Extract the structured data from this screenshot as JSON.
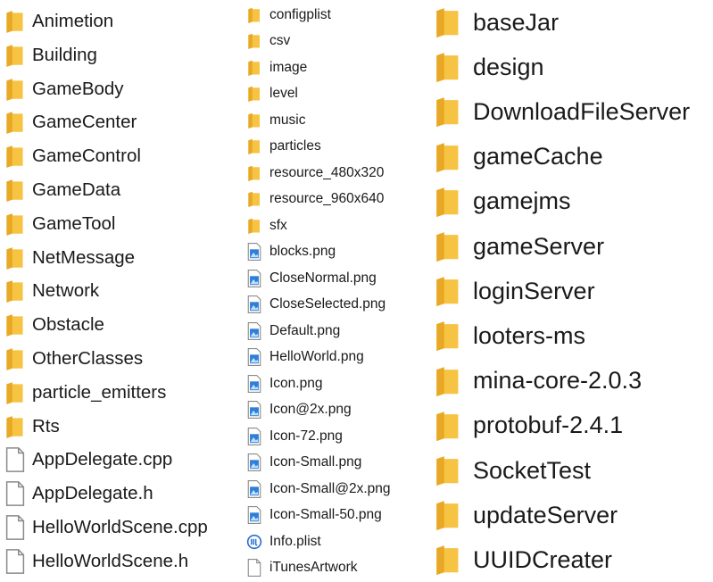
{
  "columns": [
    {
      "items": [
        {
          "name": "Animetion",
          "type": "folder"
        },
        {
          "name": "Building",
          "type": "folder"
        },
        {
          "name": "GameBody",
          "type": "folder"
        },
        {
          "name": "GameCenter",
          "type": "folder"
        },
        {
          "name": "GameControl",
          "type": "folder"
        },
        {
          "name": "GameData",
          "type": "folder"
        },
        {
          "name": "GameTool",
          "type": "folder"
        },
        {
          "name": "NetMessage",
          "type": "folder"
        },
        {
          "name": "Network",
          "type": "folder"
        },
        {
          "name": "Obstacle",
          "type": "folder"
        },
        {
          "name": "OtherClasses",
          "type": "folder"
        },
        {
          "name": "particle_emitters",
          "type": "folder"
        },
        {
          "name": "Rts",
          "type": "folder"
        },
        {
          "name": "AppDelegate.cpp",
          "type": "file"
        },
        {
          "name": "AppDelegate.h",
          "type": "file"
        },
        {
          "name": "HelloWorldScene.cpp",
          "type": "file"
        },
        {
          "name": "HelloWorldScene.h",
          "type": "file"
        }
      ]
    },
    {
      "items": [
        {
          "name": "configplist",
          "type": "folder"
        },
        {
          "name": "csv",
          "type": "folder"
        },
        {
          "name": "image",
          "type": "folder"
        },
        {
          "name": "level",
          "type": "folder"
        },
        {
          "name": "music",
          "type": "folder"
        },
        {
          "name": "particles",
          "type": "folder"
        },
        {
          "name": "resource_480x320",
          "type": "folder"
        },
        {
          "name": "resource_960x640",
          "type": "folder"
        },
        {
          "name": "sfx",
          "type": "folder"
        },
        {
          "name": "blocks.png",
          "type": "image"
        },
        {
          "name": "CloseNormal.png",
          "type": "image"
        },
        {
          "name": "CloseSelected.png",
          "type": "image"
        },
        {
          "name": "Default.png",
          "type": "image"
        },
        {
          "name": "HelloWorld.png",
          "type": "image"
        },
        {
          "name": "Icon.png",
          "type": "image"
        },
        {
          "name": "Icon@2x.png",
          "type": "image"
        },
        {
          "name": "Icon-72.png",
          "type": "image"
        },
        {
          "name": "Icon-Small.png",
          "type": "image"
        },
        {
          "name": "Icon-Small@2x.png",
          "type": "image"
        },
        {
          "name": "Icon-Small-50.png",
          "type": "image"
        },
        {
          "name": "Info.plist",
          "type": "plist"
        },
        {
          "name": "iTunesArtwork",
          "type": "file"
        }
      ]
    },
    {
      "items": [
        {
          "name": "baseJar",
          "type": "folder"
        },
        {
          "name": "design",
          "type": "folder"
        },
        {
          "name": "DownloadFileServer",
          "type": "folder"
        },
        {
          "name": "gameCache",
          "type": "folder"
        },
        {
          "name": "gamejms",
          "type": "folder"
        },
        {
          "name": "gameServer",
          "type": "folder"
        },
        {
          "name": "loginServer",
          "type": "folder"
        },
        {
          "name": "looters-ms",
          "type": "folder"
        },
        {
          "name": "mina-core-2.0.3",
          "type": "folder"
        },
        {
          "name": "protobuf-2.4.1",
          "type": "folder"
        },
        {
          "name": "SocketTest",
          "type": "folder"
        },
        {
          "name": "updateServer",
          "type": "folder"
        },
        {
          "name": "UUIDCreater",
          "type": "folder"
        }
      ]
    }
  ],
  "colors": {
    "folder_body": "#f6c342",
    "folder_back": "#e8a825",
    "file_outline": "#8a8a8a",
    "image_blue": "#2f7fd8",
    "plist_blue": "#2b6fcf"
  }
}
